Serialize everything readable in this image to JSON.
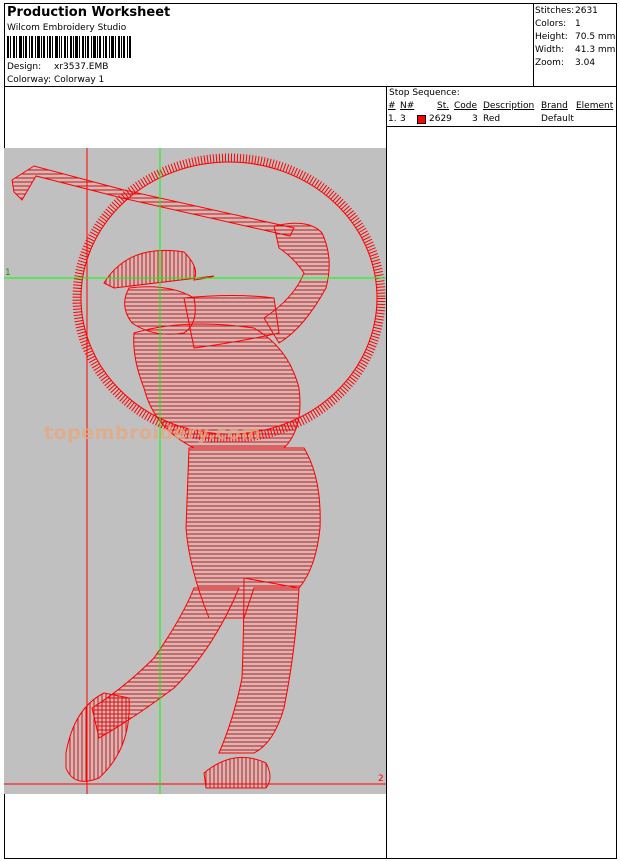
{
  "header": {
    "title": "Production Worksheet",
    "software": "Wilcom Embroidery Studio",
    "design_label": "Design:",
    "design_value": "xr3537.EMB",
    "colorway_label": "Colorway:",
    "colorway_value": "Colorway 1"
  },
  "stats": [
    {
      "label": "Stitches:",
      "value": "2631"
    },
    {
      "label": "Colors:",
      "value": "1"
    },
    {
      "label": "Height:",
      "value": "70.5 mm"
    },
    {
      "label": "Width:",
      "value": "41.3 mm"
    },
    {
      "label": "Zoom:",
      "value": "3.04"
    }
  ],
  "stop_sequence": {
    "title": "Stop Sequence:",
    "columns": [
      "#",
      "N#",
      "St.",
      "Code",
      "Description",
      "Brand",
      "Element"
    ],
    "rows": [
      {
        "num": "1.",
        "needle": "3",
        "stitches": "2629",
        "code": "3",
        "description": "Red",
        "brand": "",
        "element": "Default",
        "color": "#ff0000"
      }
    ]
  },
  "design_view": {
    "marker_start": "1",
    "marker_end": "2",
    "watermark": "topembroidery.com",
    "background": "#c0c0c0",
    "thread_color": "#ff0000",
    "guide_color": "#00ff00"
  }
}
